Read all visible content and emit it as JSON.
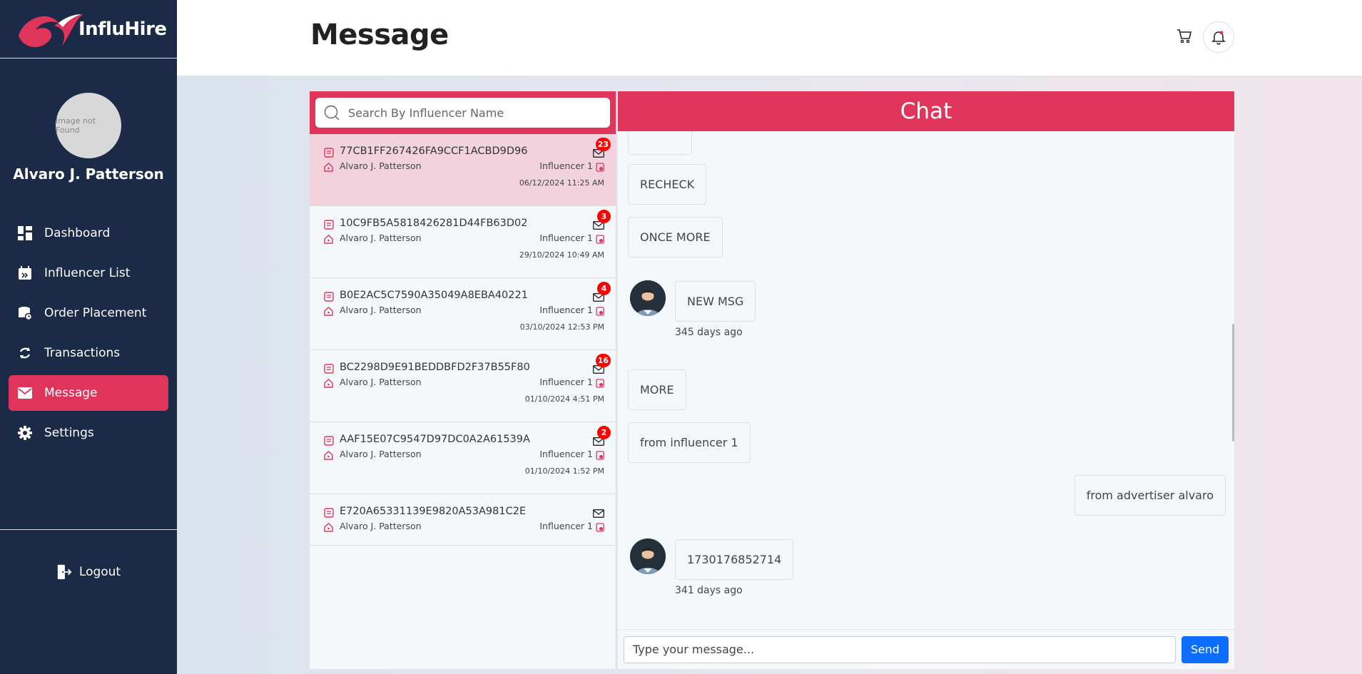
{
  "brand": {
    "name": "InfluHire"
  },
  "profile": {
    "avatar_alt": "Image not Found",
    "name": "Alvaro J. Patterson"
  },
  "nav": {
    "items": [
      {
        "label": "Dashboard",
        "icon": "dashboard-icon"
      },
      {
        "label": "Influencer List",
        "icon": "calendar-icon"
      },
      {
        "label": "Order Placement",
        "icon": "order-icon"
      },
      {
        "label": "Transactions",
        "icon": "transactions-icon"
      },
      {
        "label": "Message",
        "icon": "envelope-icon",
        "active": true
      },
      {
        "label": "Settings",
        "icon": "gear-icon"
      }
    ],
    "logout_label": "Logout"
  },
  "header": {
    "title": "Message"
  },
  "search": {
    "placeholder": "Search By Influencer Name"
  },
  "conversations": [
    {
      "id": "77CB1FF267426FA9CCF1ACBD9D96",
      "user": "Alvaro J. Patterson",
      "influencer": "Influencer 1",
      "badge": "23",
      "date": "06/12/2024 11:25 AM",
      "selected": true
    },
    {
      "id": "10C9FB5A5818426281D44FB63D02",
      "user": "Alvaro J. Patterson",
      "influencer": "Influencer 1",
      "badge": "3",
      "date": "29/10/2024 10:49 AM"
    },
    {
      "id": "B0E2AC5C7590A35049A8EBA40221",
      "user": "Alvaro J. Patterson",
      "influencer": "Influencer 1",
      "badge": "4",
      "date": "03/10/2024 12:53 PM"
    },
    {
      "id": "BC2298D9E91BEDDBFD2F37B55F80",
      "user": "Alvaro J. Patterson",
      "influencer": "Influencer 1",
      "badge": "16",
      "date": "01/10/2024 4:51 PM"
    },
    {
      "id": "AAF15E07C9547D97DC0A2A61539A",
      "user": "Alvaro J. Patterson",
      "influencer": "Influencer 1",
      "badge": "2",
      "date": "01/10/2024 1:52 PM"
    },
    {
      "id": "E720A65331139E9820A53A981C2E",
      "user": "Alvaro J. Patterson",
      "influencer": "Influencer 1",
      "badge": "",
      "date": ""
    }
  ],
  "chat": {
    "title": "Chat",
    "messages": [
      {
        "text": "RECHECK",
        "side": "left"
      },
      {
        "text": "ONCE MORE",
        "side": "left"
      },
      {
        "text": "NEW MSG",
        "side": "left",
        "avatar": true,
        "time": "345 days ago"
      },
      {
        "text": "MORE",
        "side": "left"
      },
      {
        "text": "from influencer 1",
        "side": "left"
      },
      {
        "text": "from advertiser alvaro",
        "side": "right"
      },
      {
        "text": "1730176852714",
        "side": "left",
        "avatar": true,
        "time": "341 days ago"
      }
    ],
    "input_placeholder": "Type your message...",
    "send_label": "Send"
  },
  "colors": {
    "sidebar": "#1b2a47",
    "accent": "#e0355a",
    "send": "#0d6efd",
    "badge": "#ff0000"
  }
}
